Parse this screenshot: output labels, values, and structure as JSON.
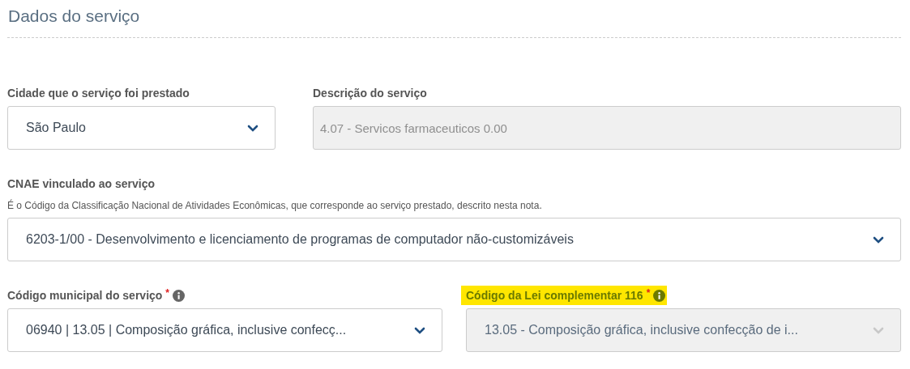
{
  "section": {
    "title": "Dados do serviço"
  },
  "rows": [
    {
      "fields": [
        {
          "kind": "select",
          "label": "Cidade que o serviço foi prestado",
          "value": "São Paulo",
          "disabled": false
        },
        {
          "kind": "text",
          "label": "Descrição do serviço",
          "value": "4.07 - Servicos farmaceuticos 0.00",
          "disabled": true
        }
      ]
    },
    {
      "fields": [
        {
          "kind": "select",
          "label": "CNAE vinculado ao serviço",
          "hint": "É o Código da Classificação Nacional de Atividades Econômicas, que corresponde ao serviço prestado, descrito nesta nota.",
          "value": "6203-1/00 - Desenvolvimento e licenciamento de programas de computador não-customizáveis",
          "disabled": false
        }
      ]
    },
    {
      "fields": [
        {
          "kind": "select",
          "label": "Código municipal do serviço",
          "required_mark": "*",
          "info": true,
          "value": "06940 | 13.05 | Composição gráfica, inclusive confecç...",
          "disabled": false
        },
        {
          "kind": "select",
          "label": "Código da Lei complementar 116",
          "required_mark": "*",
          "info": true,
          "highlighted": true,
          "value": "13.05 - Composição gráfica, inclusive confecção de i...",
          "disabled": true
        }
      ]
    }
  ]
}
